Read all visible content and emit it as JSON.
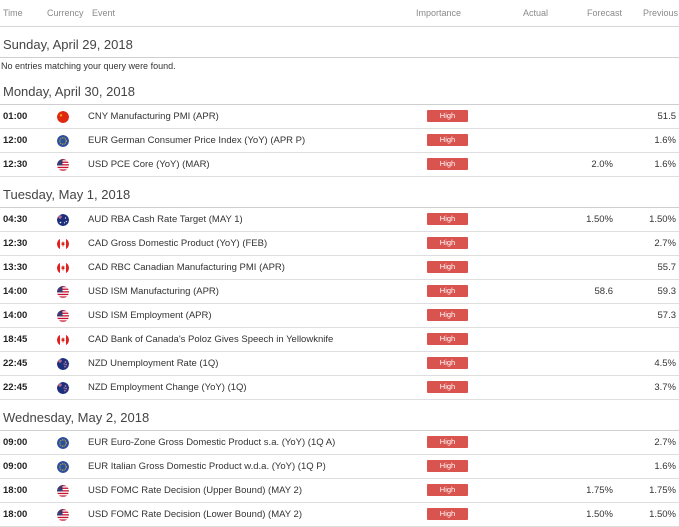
{
  "columns": {
    "time": "Time",
    "currency": "Currency",
    "event": "Event",
    "importance": "Importance",
    "actual": "Actual",
    "forecast": "Forecast",
    "previous": "Previous"
  },
  "days": [
    {
      "date": "Sunday, April 29, 2018",
      "message": "No entries matching your query were found.",
      "events": []
    },
    {
      "date": "Monday, April 30, 2018",
      "events": [
        {
          "time": "01:00",
          "flag": "cn-flag-icon",
          "event": "CNY Manufacturing PMI (APR)",
          "importance": "High",
          "actual": "",
          "forecast": "",
          "previous": "51.5"
        },
        {
          "time": "12:00",
          "flag": "eu-flag-icon",
          "event": "EUR German Consumer Price Index (YoY) (APR P)",
          "importance": "High",
          "actual": "",
          "forecast": "",
          "previous": "1.6%"
        },
        {
          "time": "12:30",
          "flag": "us-flag-icon",
          "event": "USD PCE Core (YoY) (MAR)",
          "importance": "High",
          "actual": "",
          "forecast": "2.0%",
          "previous": "1.6%"
        }
      ]
    },
    {
      "date": "Tuesday, May 1, 2018",
      "events": [
        {
          "time": "04:30",
          "flag": "au-flag-icon",
          "event": "AUD RBA Cash Rate Target (MAY 1)",
          "importance": "High",
          "actual": "",
          "forecast": "1.50%",
          "previous": "1.50%"
        },
        {
          "time": "12:30",
          "flag": "ca-flag-icon",
          "event": "CAD Gross Domestic Product (YoY) (FEB)",
          "importance": "High",
          "actual": "",
          "forecast": "",
          "previous": "2.7%"
        },
        {
          "time": "13:30",
          "flag": "ca-flag-icon",
          "event": "CAD RBC Canadian Manufacturing PMI (APR)",
          "importance": "High",
          "actual": "",
          "forecast": "",
          "previous": "55.7"
        },
        {
          "time": "14:00",
          "flag": "us-flag-icon",
          "event": "USD ISM Manufacturing (APR)",
          "importance": "High",
          "actual": "",
          "forecast": "58.6",
          "previous": "59.3"
        },
        {
          "time": "14:00",
          "flag": "us-flag-icon",
          "event": "USD ISM Employment (APR)",
          "importance": "High",
          "actual": "",
          "forecast": "",
          "previous": "57.3"
        },
        {
          "time": "18:45",
          "flag": "ca-flag-icon",
          "event": "CAD Bank of Canada's Poloz Gives Speech in Yellowknife",
          "importance": "High",
          "actual": "",
          "forecast": "",
          "previous": ""
        },
        {
          "time": "22:45",
          "flag": "nz-flag-icon",
          "event": "NZD Unemployment Rate (1Q)",
          "importance": "High",
          "actual": "",
          "forecast": "",
          "previous": "4.5%"
        },
        {
          "time": "22:45",
          "flag": "nz-flag-icon",
          "event": "NZD Employment Change (YoY) (1Q)",
          "importance": "High",
          "actual": "",
          "forecast": "",
          "previous": "3.7%"
        }
      ]
    },
    {
      "date": "Wednesday, May 2, 2018",
      "events": [
        {
          "time": "09:00",
          "flag": "eu-flag-icon",
          "event": "EUR Euro-Zone Gross Domestic Product s.a. (YoY) (1Q A)",
          "importance": "High",
          "actual": "",
          "forecast": "",
          "previous": "2.7%"
        },
        {
          "time": "09:00",
          "flag": "eu-flag-icon",
          "event": "EUR Italian Gross Domestic Product w.d.a. (YoY) (1Q P)",
          "importance": "High",
          "actual": "",
          "forecast": "",
          "previous": "1.6%"
        },
        {
          "time": "18:00",
          "flag": "us-flag-icon",
          "event": "USD FOMC Rate Decision (Upper Bound) (MAY 2)",
          "importance": "High",
          "actual": "",
          "forecast": "1.75%",
          "previous": "1.75%"
        },
        {
          "time": "18:00",
          "flag": "us-flag-icon",
          "event": "USD FOMC Rate Decision (Lower Bound) (MAY 2)",
          "importance": "High",
          "actual": "",
          "forecast": "1.50%",
          "previous": "1.50%"
        }
      ]
    }
  ],
  "colors": {
    "importance_high": "#d9534f"
  }
}
